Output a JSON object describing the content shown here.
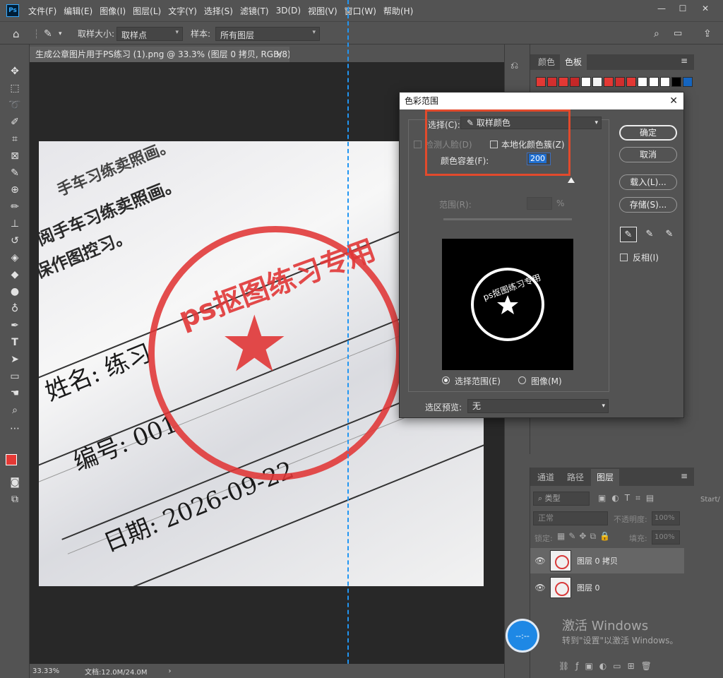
{
  "menubar": {
    "logo": "Ps",
    "items": [
      "文件(F)",
      "编辑(E)",
      "图像(I)",
      "图层(L)",
      "文字(Y)",
      "选择(S)",
      "滤镜(T)",
      "3D(D)",
      "视图(V)",
      "窗口(W)",
      "帮助(H)"
    ],
    "minimize": "—",
    "maximize": "☐",
    "close": "✕"
  },
  "options": {
    "sample_size_label": "取样大小:",
    "sample_size_value": "取样点",
    "sample_label": "样本:",
    "sample_value": "所有图层"
  },
  "document": {
    "tab_title": "生成公章图片用于PS练习 (1).png @ 33.3% (图层 0 拷贝, RGB/8) *",
    "tab_close": "×",
    "image_text": {
      "stamp_text": "ps抠图练习专用",
      "star": "★",
      "name": "姓名: 练习",
      "number": "编号: 001",
      "date": "日期: 2026-09-22",
      "line1": "手车习练卖照画。",
      "line2": "阅手车习练卖照画。",
      "line3": "保作图控习。",
      "line4": "作图控习。"
    }
  },
  "status": {
    "zoom": "33.33%",
    "doc_info": "文档:12.0M/24.0M"
  },
  "swatch_panel": {
    "tabs": [
      "颜色",
      "色板"
    ],
    "swatches": [
      "#e53935",
      "#d32f2f",
      "#e53935",
      "#c62828",
      "#ffffff",
      "#f5f5f5",
      "#e53935",
      "#d32f2f",
      "#e53935",
      "#ffffff",
      "#000000",
      "#1565c0"
    ]
  },
  "dialog": {
    "title": "色彩范围",
    "close": "✕",
    "select_label": "选择(C):",
    "select_value": "取样颜色",
    "detect_faces": "检测人脸(D)",
    "localized_clusters": "本地化颜色簇(Z)",
    "fuzziness_label": "颜色容差(F):",
    "fuzziness_value": "200",
    "range_label": "范围(R):",
    "range_unit": "%",
    "radio_selection": "选择范围(E)",
    "radio_image": "图像(M)",
    "preview_label": "选区预览:",
    "preview_value": "无",
    "ok": "确定",
    "cancel": "取消",
    "load": "载入(L)...",
    "save": "存储(S)...",
    "invert": "反相(I)",
    "preview_text": "ps抠图练习专用"
  },
  "layers_panel": {
    "tabs": [
      "通道",
      "路径",
      "图层"
    ],
    "filter_label": "类型",
    "blend_mode": "正常",
    "opacity_label": "不透明度:",
    "opacity_value": "100%",
    "lock_label": "锁定:",
    "fill_label": "填充:",
    "fill_value": "100%",
    "layers": [
      {
        "name": "图层 0 拷贝",
        "selected": true
      },
      {
        "name": "图层 0",
        "selected": false
      }
    ],
    "side_text": "Start/"
  },
  "watermark": {
    "line1": "激活 Windows",
    "line2": "转到\"设置\"以激活 Windows。"
  },
  "float_button": "--:--"
}
